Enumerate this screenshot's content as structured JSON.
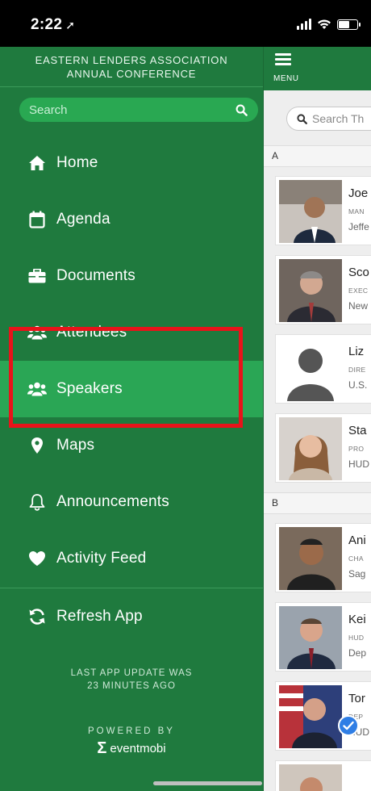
{
  "status_bar": {
    "time": "2:22"
  },
  "drawer": {
    "title_line1": "EASTERN LENDERS ASSOCIATION",
    "title_line2": "ANNUAL CONFERENCE",
    "search_placeholder": "Search",
    "items": [
      {
        "label": "Home",
        "icon": "home-icon"
      },
      {
        "label": "Agenda",
        "icon": "calendar-icon"
      },
      {
        "label": "Documents",
        "icon": "briefcase-icon"
      },
      {
        "label": "Attendees",
        "icon": "users-icon"
      },
      {
        "label": "Speakers",
        "icon": "users-icon",
        "active": true
      },
      {
        "label": "Maps",
        "icon": "map-pin-icon"
      },
      {
        "label": "Announcements",
        "icon": "bell-icon"
      },
      {
        "label": "Activity Feed",
        "icon": "heart-icon"
      },
      {
        "label": "Refresh App",
        "icon": "refresh-icon"
      }
    ],
    "update_line1": "LAST APP UPDATE WAS",
    "update_line2": "23 MINUTES AGO",
    "powered_by": "POWERED BY",
    "brand": "eventmobi"
  },
  "content": {
    "menu_label": "MENU",
    "search_placeholder": "Search Th",
    "sections": [
      "A",
      "B"
    ],
    "speakers": [
      {
        "name": "Joe",
        "title": "MAN",
        "org": "Jeffe"
      },
      {
        "name": "Sco",
        "title": "EXEC",
        "org": "New"
      },
      {
        "name": "Liz",
        "title": "DIRE",
        "org": "U.S."
      },
      {
        "name": "Sta",
        "title": "PRO",
        "org": "HUD"
      },
      {
        "name": "Ani",
        "title": "CHA",
        "org": "Sag"
      },
      {
        "name": "Kei",
        "title": "HUD",
        "org": "Dep"
      },
      {
        "name": "Tor",
        "title": "DEP",
        "org": "HUD"
      }
    ]
  },
  "colors": {
    "drawer_bg": "#1f7a3e",
    "active_item": "#2aa655",
    "highlight": "#e8131a"
  }
}
